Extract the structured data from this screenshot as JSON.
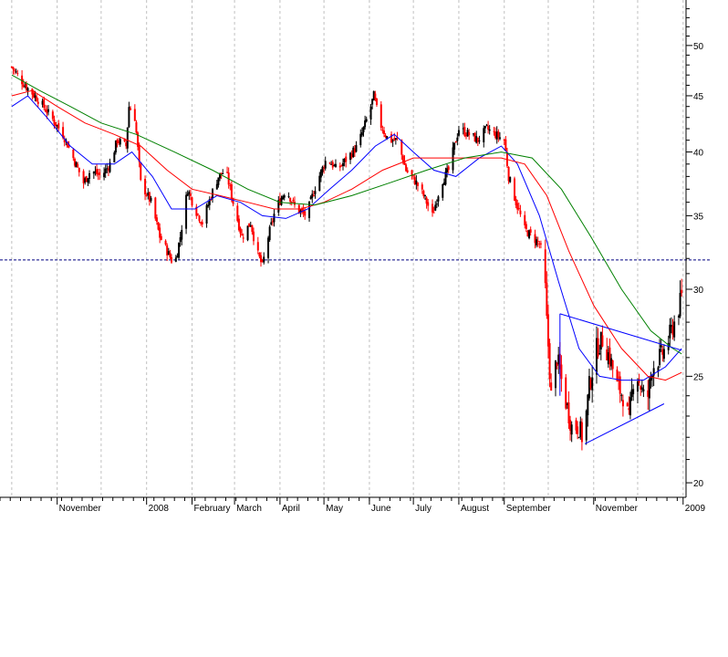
{
  "chart_data": {
    "type": "candlestick",
    "title": "",
    "xlabel": "",
    "ylabel": "",
    "y_scale": "log",
    "ylim": [
      19.4,
      55
    ],
    "y_ticks": [
      20,
      25,
      30,
      35,
      40,
      45,
      50
    ],
    "y_tick_labels": [
      "20",
      "25",
      "30",
      "35",
      "40",
      "45",
      "50"
    ],
    "x_labels": [
      "November",
      "2008",
      "February",
      "March",
      "April",
      "May",
      "June",
      "July",
      "August",
      "September",
      "November",
      "2009"
    ],
    "grid": "vertical dashed monthly lines",
    "reference_level": 31.9,
    "colors": {
      "up": "#000000",
      "down": "#ff0000",
      "ma_short": "#0000ff",
      "ma_medium": "#ff0000",
      "ma_long": "#008000",
      "trendlines": "#0000ff",
      "grid": "#c0c0c0"
    },
    "close_path": [
      [
        "2007-10-01",
        47.8
      ],
      [
        "2007-10-10",
        46.0
      ],
      [
        "2007-10-20",
        44.5
      ],
      [
        "2007-10-28",
        43.0
      ],
      [
        "2007-11-05",
        41.5
      ],
      [
        "2007-11-12",
        39.5
      ],
      [
        "2007-11-19",
        37.5
      ],
      [
        "2007-11-24",
        38.5
      ],
      [
        "2007-12-01",
        38.0
      ],
      [
        "2007-12-07",
        39.0
      ],
      [
        "2007-12-12",
        41.0
      ],
      [
        "2007-12-18",
        40.5
      ],
      [
        "2007-12-20",
        44.0
      ],
      [
        "2007-12-24",
        43.0
      ],
      [
        "2007-12-28",
        37.5
      ],
      [
        "2008-01-04",
        36.0
      ],
      [
        "2008-01-10",
        33.5
      ],
      [
        "2008-01-15",
        32.5
      ],
      [
        "2008-01-20",
        31.5
      ],
      [
        "2008-01-24",
        33.5
      ],
      [
        "2008-01-29",
        37.0
      ],
      [
        "2008-02-03",
        35.5
      ],
      [
        "2008-02-08",
        34.5
      ],
      [
        "2008-02-14",
        36.5
      ],
      [
        "2008-02-19",
        38.0
      ],
      [
        "2008-02-24",
        38.5
      ],
      [
        "2008-03-01",
        35.5
      ],
      [
        "2008-03-06",
        33.5
      ],
      [
        "2008-03-12",
        34.5
      ],
      [
        "2008-03-16",
        32.5
      ],
      [
        "2008-03-20",
        31.5
      ],
      [
        "2008-03-24",
        33.5
      ],
      [
        "2008-03-29",
        35.5
      ],
      [
        "2008-04-05",
        37.0
      ],
      [
        "2008-04-12",
        35.5
      ],
      [
        "2008-04-19",
        35.0
      ],
      [
        "2008-04-26",
        37.5
      ],
      [
        "2008-05-03",
        39.5
      ],
      [
        "2008-05-10",
        38.5
      ],
      [
        "2008-05-17",
        39.5
      ],
      [
        "2008-05-24",
        40.5
      ],
      [
        "2008-05-28",
        42.0
      ],
      [
        "2008-06-01",
        43.5
      ],
      [
        "2008-06-04",
        45.0
      ],
      [
        "2008-06-08",
        42.5
      ],
      [
        "2008-06-14",
        41.0
      ],
      [
        "2008-06-20",
        41.0
      ],
      [
        "2008-06-26",
        38.5
      ],
      [
        "2008-07-03",
        37.5
      ],
      [
        "2008-07-08",
        36.5
      ],
      [
        "2008-07-14",
        35.0
      ],
      [
        "2008-07-20",
        37.5
      ],
      [
        "2008-07-25",
        38.5
      ],
      [
        "2008-08-01",
        42.0
      ],
      [
        "2008-08-08",
        41.5
      ],
      [
        "2008-08-14",
        41.0
      ],
      [
        "2008-08-20",
        42.0
      ],
      [
        "2008-08-26",
        41.5
      ],
      [
        "2008-09-01",
        41.0
      ],
      [
        "2008-09-04",
        38.0
      ],
      [
        "2008-09-09",
        36.0
      ],
      [
        "2008-09-15",
        34.0
      ],
      [
        "2008-09-20",
        33.5
      ],
      [
        "2008-09-25",
        33.0
      ],
      [
        "2008-09-28",
        32.0
      ],
      [
        "2008-09-30",
        28.0
      ],
      [
        "2008-10-03",
        24.0
      ],
      [
        "2008-10-07",
        26.0
      ],
      [
        "2008-10-12",
        24.0
      ],
      [
        "2008-10-17",
        22.5
      ],
      [
        "2008-10-22",
        22.5
      ],
      [
        "2008-10-25",
        21.8
      ],
      [
        "2008-10-29",
        24.5
      ],
      [
        "2008-11-03",
        26.5
      ],
      [
        "2008-11-07",
        27.0
      ],
      [
        "2008-11-12",
        26.0
      ],
      [
        "2008-11-17",
        24.5
      ],
      [
        "2008-11-21",
        24.0
      ],
      [
        "2008-11-25",
        22.8
      ],
      [
        "2008-11-29",
        25.5
      ],
      [
        "2008-12-03",
        24.5
      ],
      [
        "2008-12-07",
        23.5
      ],
      [
        "2008-12-11",
        25.5
      ],
      [
        "2008-12-16",
        26.0
      ],
      [
        "2008-12-20",
        26.5
      ],
      [
        "2008-12-24",
        27.5
      ],
      [
        "2008-12-28",
        28.5
      ],
      [
        "2008-12-31",
        29.5
      ]
    ],
    "moving_averages": [
      {
        "color": "#0000ff",
        "points": [
          [
            "2007-10-01",
            44.0
          ],
          [
            "2007-10-12",
            45.0
          ],
          [
            "2007-10-25",
            43.0
          ],
          [
            "2007-11-10",
            40.5
          ],
          [
            "2007-11-25",
            39.0
          ],
          [
            "2007-12-10",
            39.0
          ],
          [
            "2007-12-22",
            40.0
          ],
          [
            "2008-01-05",
            38.0
          ],
          [
            "2008-01-18",
            35.5
          ],
          [
            "2008-02-03",
            35.5
          ],
          [
            "2008-02-18",
            36.5
          ],
          [
            "2008-03-05",
            36.0
          ],
          [
            "2008-03-20",
            35.0
          ],
          [
            "2008-04-05",
            34.8
          ],
          [
            "2008-04-20",
            35.5
          ],
          [
            "2008-05-05",
            37.0
          ],
          [
            "2008-05-20",
            38.5
          ],
          [
            "2008-06-05",
            40.5
          ],
          [
            "2008-06-18",
            41.5
          ],
          [
            "2008-07-01",
            40.0
          ],
          [
            "2008-07-15",
            38.5
          ],
          [
            "2008-07-30",
            38.0
          ],
          [
            "2008-08-15",
            39.5
          ],
          [
            "2008-08-30",
            40.5
          ],
          [
            "2008-09-10",
            39.0
          ],
          [
            "2008-09-25",
            35.0
          ],
          [
            "2008-10-08",
            30.5
          ],
          [
            "2008-10-22",
            26.5
          ],
          [
            "2008-11-05",
            25.0
          ],
          [
            "2008-11-20",
            24.8
          ],
          [
            "2008-12-05",
            24.8
          ],
          [
            "2008-12-20",
            25.5
          ],
          [
            "2008-12-31",
            26.5
          ]
        ]
      },
      {
        "color": "#ff0000",
        "points": [
          [
            "2007-10-01",
            45.0
          ],
          [
            "2007-10-15",
            45.5
          ],
          [
            "2007-11-01",
            44.0
          ],
          [
            "2007-11-20",
            42.5
          ],
          [
            "2007-12-10",
            41.5
          ],
          [
            "2007-12-28",
            40.5
          ],
          [
            "2008-01-15",
            38.5
          ],
          [
            "2008-02-01",
            37.0
          ],
          [
            "2008-02-20",
            36.5
          ],
          [
            "2008-03-10",
            36.0
          ],
          [
            "2008-03-28",
            35.5
          ],
          [
            "2008-04-15",
            35.5
          ],
          [
            "2008-05-01",
            36.0
          ],
          [
            "2008-05-20",
            37.0
          ],
          [
            "2008-06-10",
            38.5
          ],
          [
            "2008-07-01",
            39.5
          ],
          [
            "2008-07-20",
            39.5
          ],
          [
            "2008-08-10",
            39.5
          ],
          [
            "2008-08-30",
            39.5
          ],
          [
            "2008-09-15",
            39.0
          ],
          [
            "2008-09-30",
            36.5
          ],
          [
            "2008-10-15",
            32.5
          ],
          [
            "2008-11-01",
            29.0
          ],
          [
            "2008-11-20",
            26.5
          ],
          [
            "2008-12-08",
            25.0
          ],
          [
            "2008-12-20",
            24.8
          ],
          [
            "2008-12-31",
            25.2
          ]
        ]
      },
      {
        "color": "#008000",
        "points": [
          [
            "2007-10-01",
            47.0
          ],
          [
            "2007-10-20",
            45.5
          ],
          [
            "2007-11-10",
            44.0
          ],
          [
            "2007-12-01",
            42.5
          ],
          [
            "2007-12-25",
            41.5
          ],
          [
            "2008-01-20",
            40.0
          ],
          [
            "2008-02-15",
            38.5
          ],
          [
            "2008-03-10",
            37.0
          ],
          [
            "2008-04-01",
            36.0
          ],
          [
            "2008-04-25",
            35.8
          ],
          [
            "2008-05-20",
            36.5
          ],
          [
            "2008-06-15",
            37.5
          ],
          [
            "2008-07-10",
            38.5
          ],
          [
            "2008-08-05",
            39.5
          ],
          [
            "2008-08-30",
            40.0
          ],
          [
            "2008-09-20",
            39.5
          ],
          [
            "2008-10-10",
            37.0
          ],
          [
            "2008-10-30",
            33.5
          ],
          [
            "2008-11-20",
            30.0
          ],
          [
            "2008-12-10",
            27.5
          ],
          [
            "2008-12-25",
            26.5
          ],
          [
            "2008-12-31",
            26.2
          ]
        ]
      }
    ],
    "trendlines": [
      {
        "from": [
          "2008-10-09",
          28.5
        ],
        "to": [
          "2008-12-31",
          26.4
        ]
      },
      {
        "from": [
          "2008-10-26",
          21.7
        ],
        "to": [
          "2008-12-19",
          23.6
        ]
      },
      {
        "from": [
          "2008-10-09",
          28.5
        ],
        "to": [
          "2008-10-09",
          24.0
        ]
      }
    ]
  }
}
